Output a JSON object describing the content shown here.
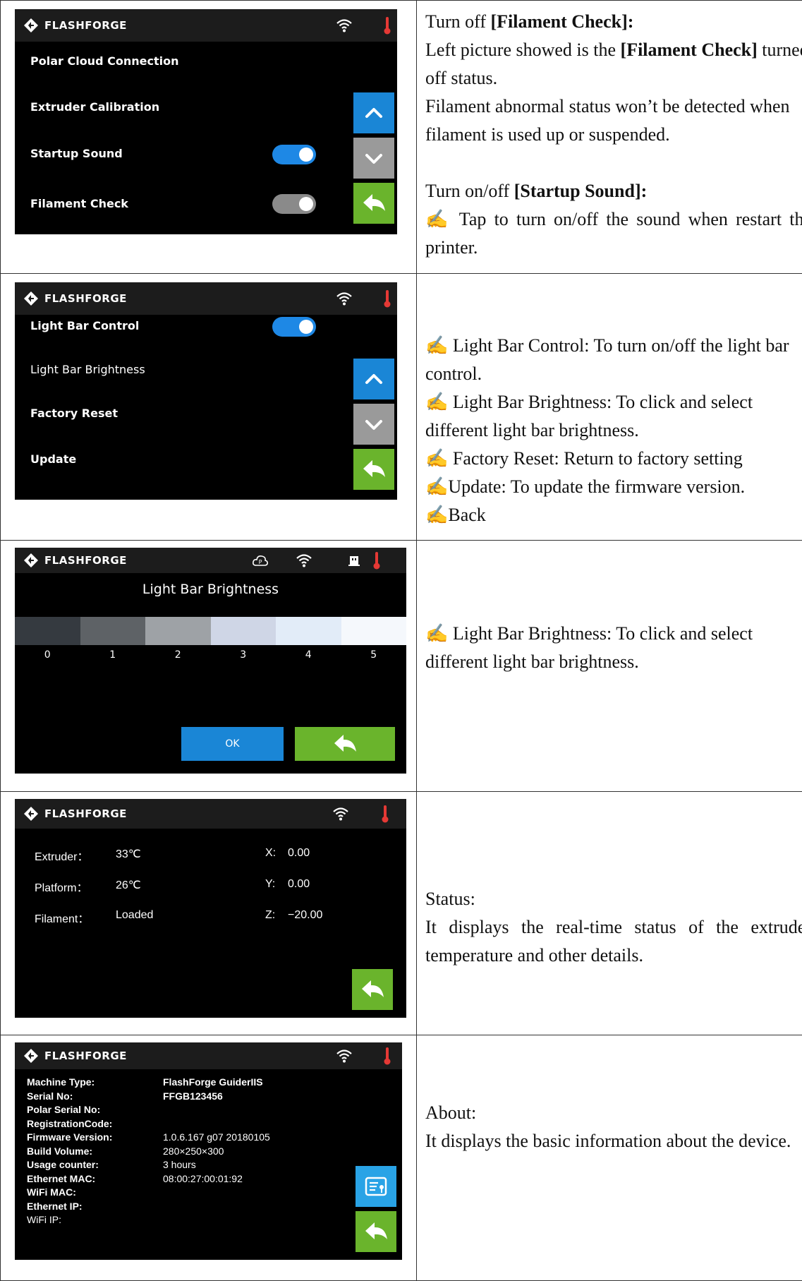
{
  "brand": "FLASHFORGE",
  "colors": {
    "accent_blue": "#1a86d6",
    "back_green": "#6ab42c",
    "gray": "#9a9a9a",
    "thermo_red": "#e53935"
  },
  "row1": {
    "screen": {
      "items": [
        "Polar Cloud Connection",
        "Extruder Calibration",
        "Startup Sound",
        "Filament Check"
      ],
      "startup_sound_on": true,
      "filament_check_on": false
    },
    "text": {
      "a1": "Turn off ",
      "a2": "[Filament Check]:",
      "b1": "Left picture showed is the ",
      "b2": "[Filament Check]",
      "b3": " turned off status.",
      "c": "Filament abnormal status won’t be detected when filament is used up or suspended.",
      "d1": "Turn on/off ",
      "d2": "[Startup Sound]:",
      "e": "✍ Tap to turn on/off the sound when restart the printer."
    }
  },
  "row2": {
    "screen": {
      "items": [
        "Light Bar Control",
        "Light Bar Brightness",
        "Factory Reset",
        "Update"
      ],
      "light_bar_on": true
    },
    "text": {
      "l1": "✍ Light Bar Control: To turn on/off the light bar control.",
      "l2": "✍ Light Bar Brightness: To click and select different light bar brightness.",
      "l3": "✍ Factory Reset: Return to factory setting",
      "l4": "✍Update: To update the firmware version.",
      "l5": "✍Back"
    }
  },
  "row3": {
    "screen": {
      "title": "Light Bar Brightness",
      "levels": [
        "0",
        "1",
        "2",
        "3",
        "4",
        "5"
      ],
      "level_colors": [
        "#353a40",
        "#5e6266",
        "#9ea2a6",
        "#cfd6e6",
        "#e2ecf8",
        "#f5f8fc"
      ],
      "ok": "OK"
    },
    "text": {
      "l1": "✍ Light Bar Brightness: To click and select different light bar brightness."
    }
  },
  "row4": {
    "screen": {
      "rows": [
        {
          "label": "Extruder：",
          "value": "33℃",
          "axis": "X:",
          "axis_value": "0.00"
        },
        {
          "label": "Platform：",
          "value": "26℃",
          "axis": "Y:",
          "axis_value": "0.00"
        },
        {
          "label": "Filament：",
          "value": "Loaded",
          "axis": "Z:",
          "axis_value": "−20.00"
        }
      ]
    },
    "text": {
      "title": "Status:",
      "body": "It displays the real-time status of the extruder temperature and other details."
    }
  },
  "row5": {
    "screen": {
      "rows": [
        {
          "label": "Machine Type:",
          "value": "FlashForge GuiderIIS"
        },
        {
          "label": "Serial No:",
          "value": "FFGB123456"
        },
        {
          "label": "Polar Serial No:",
          "value": ""
        },
        {
          "label": "RegistrationCode:",
          "value": ""
        },
        {
          "label": "Firmware Version:",
          "value": "1.0.6.167 g07 20180105"
        },
        {
          "label": "Build Volume:",
          "value": "280×250×300"
        },
        {
          "label": "Usage counter:",
          "value": "3 hours"
        },
        {
          "label": "Ethernet MAC:",
          "value": "08:00:27:00:01:92"
        },
        {
          "label": "WiFi MAC:",
          "value": ""
        },
        {
          "label": "Ethernet IP:",
          "value": ""
        },
        {
          "label": "WiFi IP:",
          "value": ""
        }
      ]
    },
    "text": {
      "title": "About:",
      "body": "It displays the basic information about the device."
    }
  }
}
